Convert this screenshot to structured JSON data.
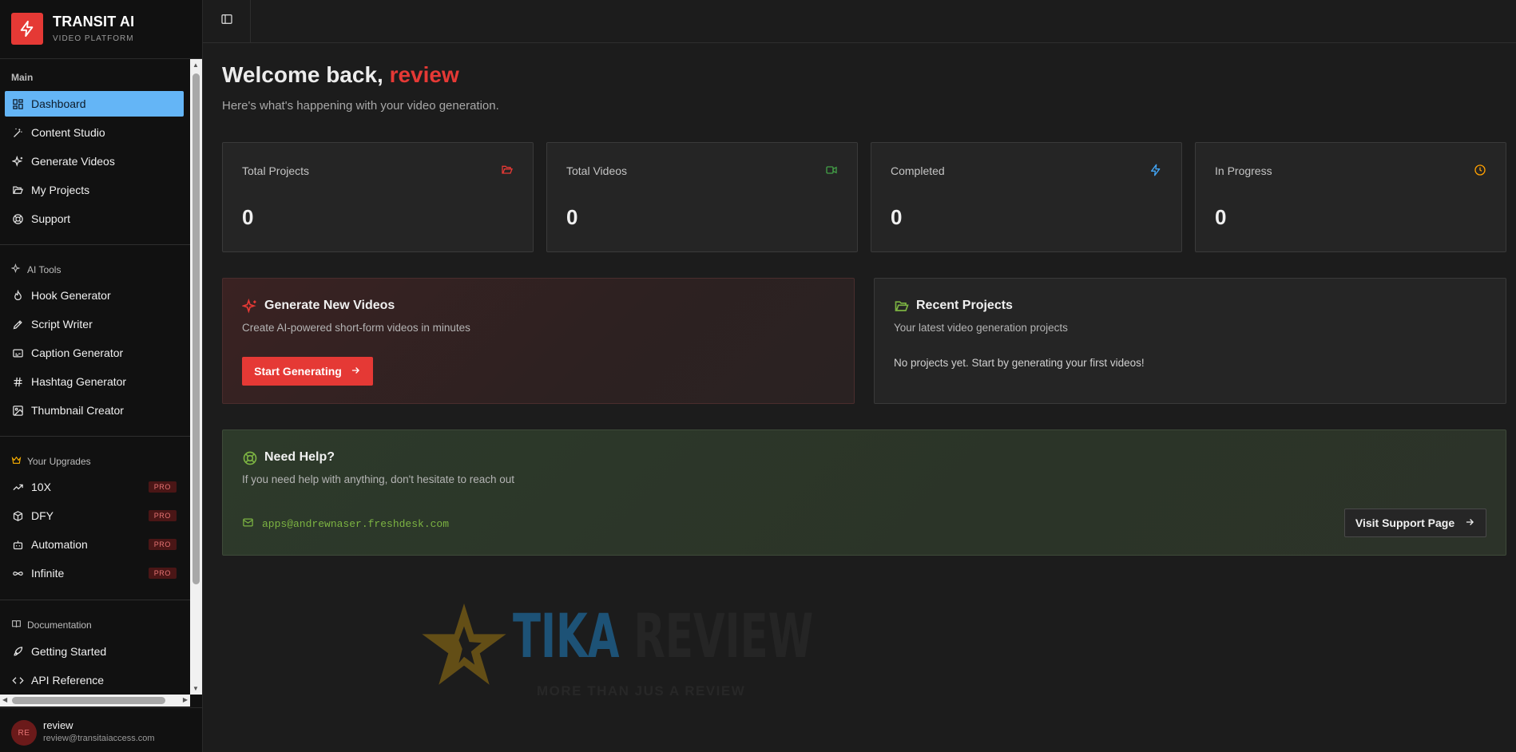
{
  "brand": {
    "name": "TRANSIT AI",
    "tagline": "VIDEO PLATFORM"
  },
  "sidebar": {
    "sections": [
      {
        "label": "Main",
        "items": [
          {
            "label": "Dashboard",
            "icon": "dashboard-icon",
            "active": true
          },
          {
            "label": "Content Studio",
            "icon": "magic-wand-icon"
          },
          {
            "label": "Generate Videos",
            "icon": "sparkles-icon"
          },
          {
            "label": "My Projects",
            "icon": "folder-open-icon"
          },
          {
            "label": "Support",
            "icon": "lifebuoy-icon"
          }
        ]
      },
      {
        "label": "AI Tools",
        "icon": "sparkles-icon",
        "items": [
          {
            "label": "Hook Generator",
            "icon": "flame-icon"
          },
          {
            "label": "Script Writer",
            "icon": "pen-icon"
          },
          {
            "label": "Caption Generator",
            "icon": "captions-icon"
          },
          {
            "label": "Hashtag Generator",
            "icon": "hash-icon"
          },
          {
            "label": "Thumbnail Creator",
            "icon": "image-edit-icon"
          }
        ]
      },
      {
        "label": "Your Upgrades",
        "icon": "crown-icon",
        "items": [
          {
            "label": "10X",
            "icon": "trending-up-icon",
            "badge": "PRO"
          },
          {
            "label": "DFY",
            "icon": "package-icon",
            "badge": "PRO"
          },
          {
            "label": "Automation",
            "icon": "bot-icon",
            "badge": "PRO"
          },
          {
            "label": "Infinite",
            "icon": "infinity-icon",
            "badge": "PRO"
          }
        ]
      },
      {
        "label": "Documentation",
        "icon": "book-icon",
        "items": [
          {
            "label": "Getting Started",
            "icon": "rocket-icon"
          },
          {
            "label": "API Reference",
            "icon": "code-icon"
          }
        ]
      }
    ]
  },
  "user": {
    "initials": "RE",
    "name": "review",
    "email": "review@transitaiaccess.com"
  },
  "main": {
    "welcome_prefix": "Welcome back, ",
    "welcome_name": "review",
    "subtitle": "Here's what's happening with your video generation.",
    "stats": [
      {
        "label": "Total Projects",
        "value": "0",
        "icon": "folder-icon",
        "color": "#e53935"
      },
      {
        "label": "Total Videos",
        "value": "0",
        "icon": "video-icon",
        "color": "#43a047"
      },
      {
        "label": "Completed",
        "value": "0",
        "icon": "zap-icon",
        "color": "#42a5f5"
      },
      {
        "label": "In Progress",
        "value": "0",
        "icon": "clock-icon",
        "color": "#ffa000"
      }
    ],
    "generate": {
      "title": "Generate New Videos",
      "desc": "Create AI-powered short-form videos in minutes",
      "button": "Start Generating"
    },
    "recent": {
      "title": "Recent Projects",
      "desc": "Your latest video generation projects",
      "empty": "No projects yet. Start by generating your first videos!"
    },
    "help": {
      "title": "Need Help?",
      "desc": "If you need help with anything, don't hesitate to reach out",
      "email": "apps@andrewnaser.freshdesk.com",
      "button": "Visit Support Page"
    }
  },
  "watermark": {
    "brand_a": "TIKA",
    "brand_b": "REVIEW",
    "slogan": "MORE THAN JUS A REVIEW"
  },
  "colors": {
    "accent": "#e53935",
    "active_nav": "#64b5f6",
    "success": "#7cb342"
  }
}
